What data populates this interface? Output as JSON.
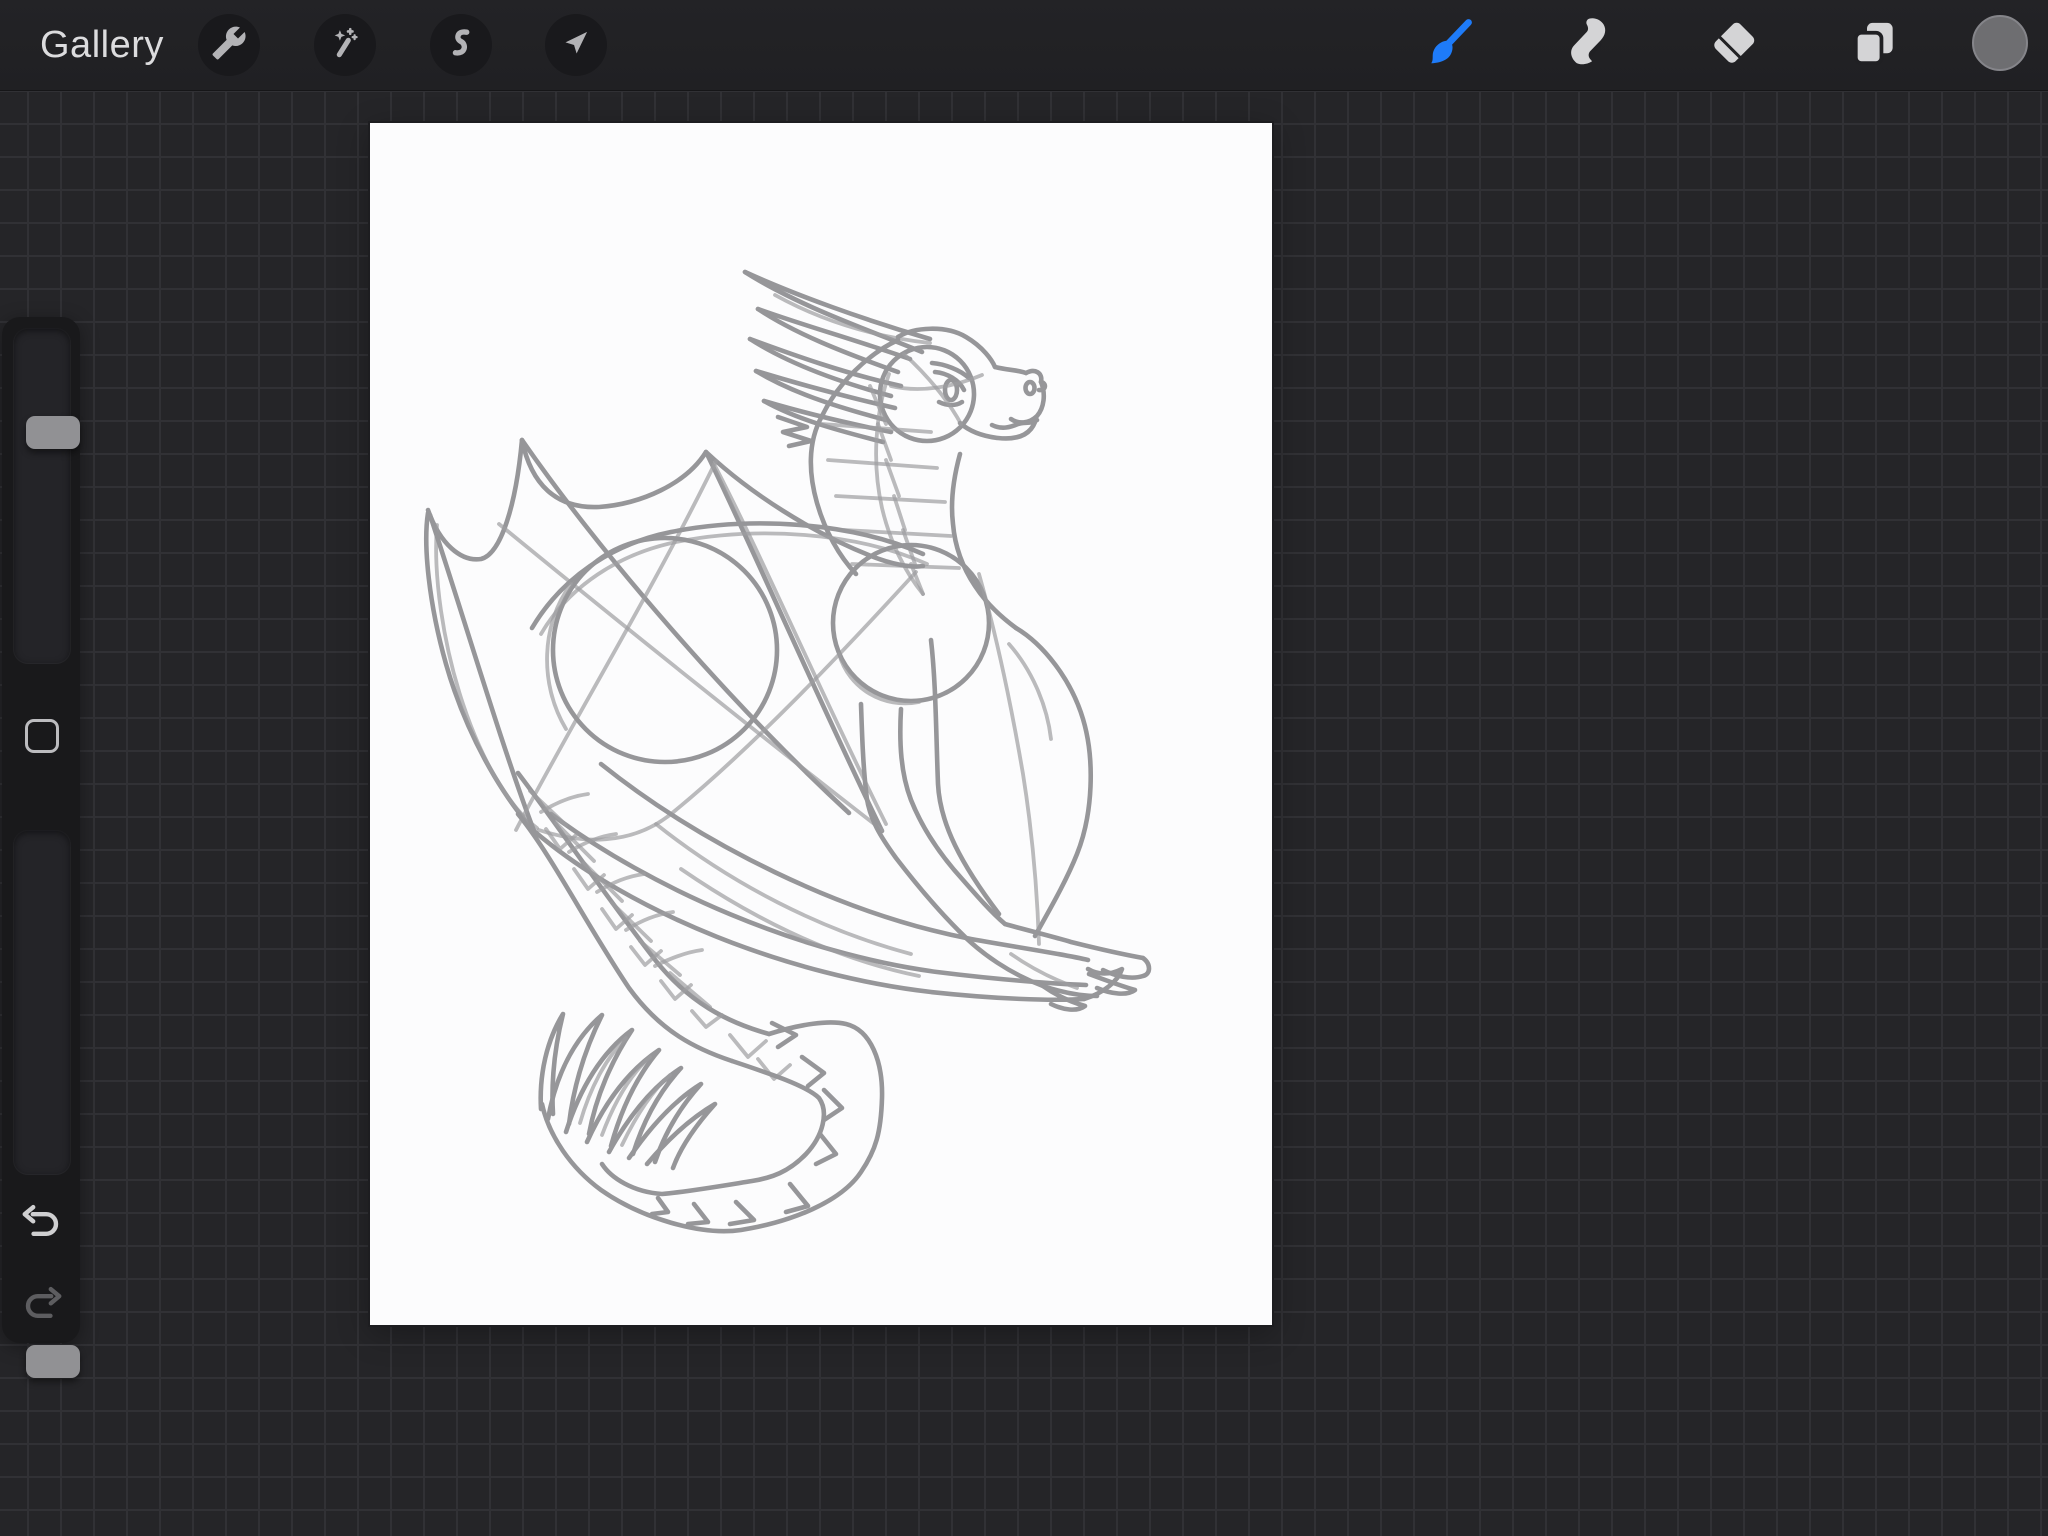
{
  "app": {
    "name": "procreate-canvas-view"
  },
  "top_bar": {
    "gallery_label": "Gallery",
    "left_tools": [
      {
        "id": "actions",
        "icon": "wrench-icon"
      },
      {
        "id": "adjustments",
        "icon": "magic-wand-icon"
      },
      {
        "id": "selection",
        "icon": "selection-s-icon"
      },
      {
        "id": "transform",
        "icon": "transform-arrow-icon"
      }
    ],
    "right_tools": [
      {
        "id": "paint",
        "icon": "paint-brush-icon",
        "active": true
      },
      {
        "id": "smudge",
        "icon": "smudge-finger-icon",
        "active": false
      },
      {
        "id": "erase",
        "icon": "eraser-icon",
        "active": false
      },
      {
        "id": "layers",
        "icon": "layers-icon",
        "active": false
      },
      {
        "id": "color",
        "icon": "color-swatch-circle",
        "swatch_color": "#6e6e71",
        "active": false
      }
    ]
  },
  "sidebar": {
    "brush_size_slider": {
      "orientation": "vertical",
      "handle_position": "upper-quarter"
    },
    "modify_button": {
      "shape": "rounded-square"
    },
    "opacity_slider": {
      "orientation": "vertical",
      "handle_position": "top"
    },
    "undo": {
      "icon": "undo-arrow-icon",
      "enabled": true
    },
    "redo": {
      "icon": "redo-arrow-icon",
      "enabled": false
    }
  },
  "canvas": {
    "paper_color": "#fcfcfd",
    "pencil_color": "#8b8b8e",
    "artwork_description": "rough pencil sketch of a dragon: head with long horn crest, scaled neck, two bat wings with scalloped edges, construction circles for body and chest, clawed forelegs, scaled belly band, tail curling into a loop with chevron spikes and a feathery tuft"
  },
  "colors": {
    "accent_blue": "#1e7bf8",
    "workspace_background": "#252528",
    "grid_line": "#313135",
    "top_bar": "#212124",
    "sidebar_panel": "#19191b",
    "icon_gray": "#d4d4d6",
    "swatch_gray": "#6e6e71"
  }
}
